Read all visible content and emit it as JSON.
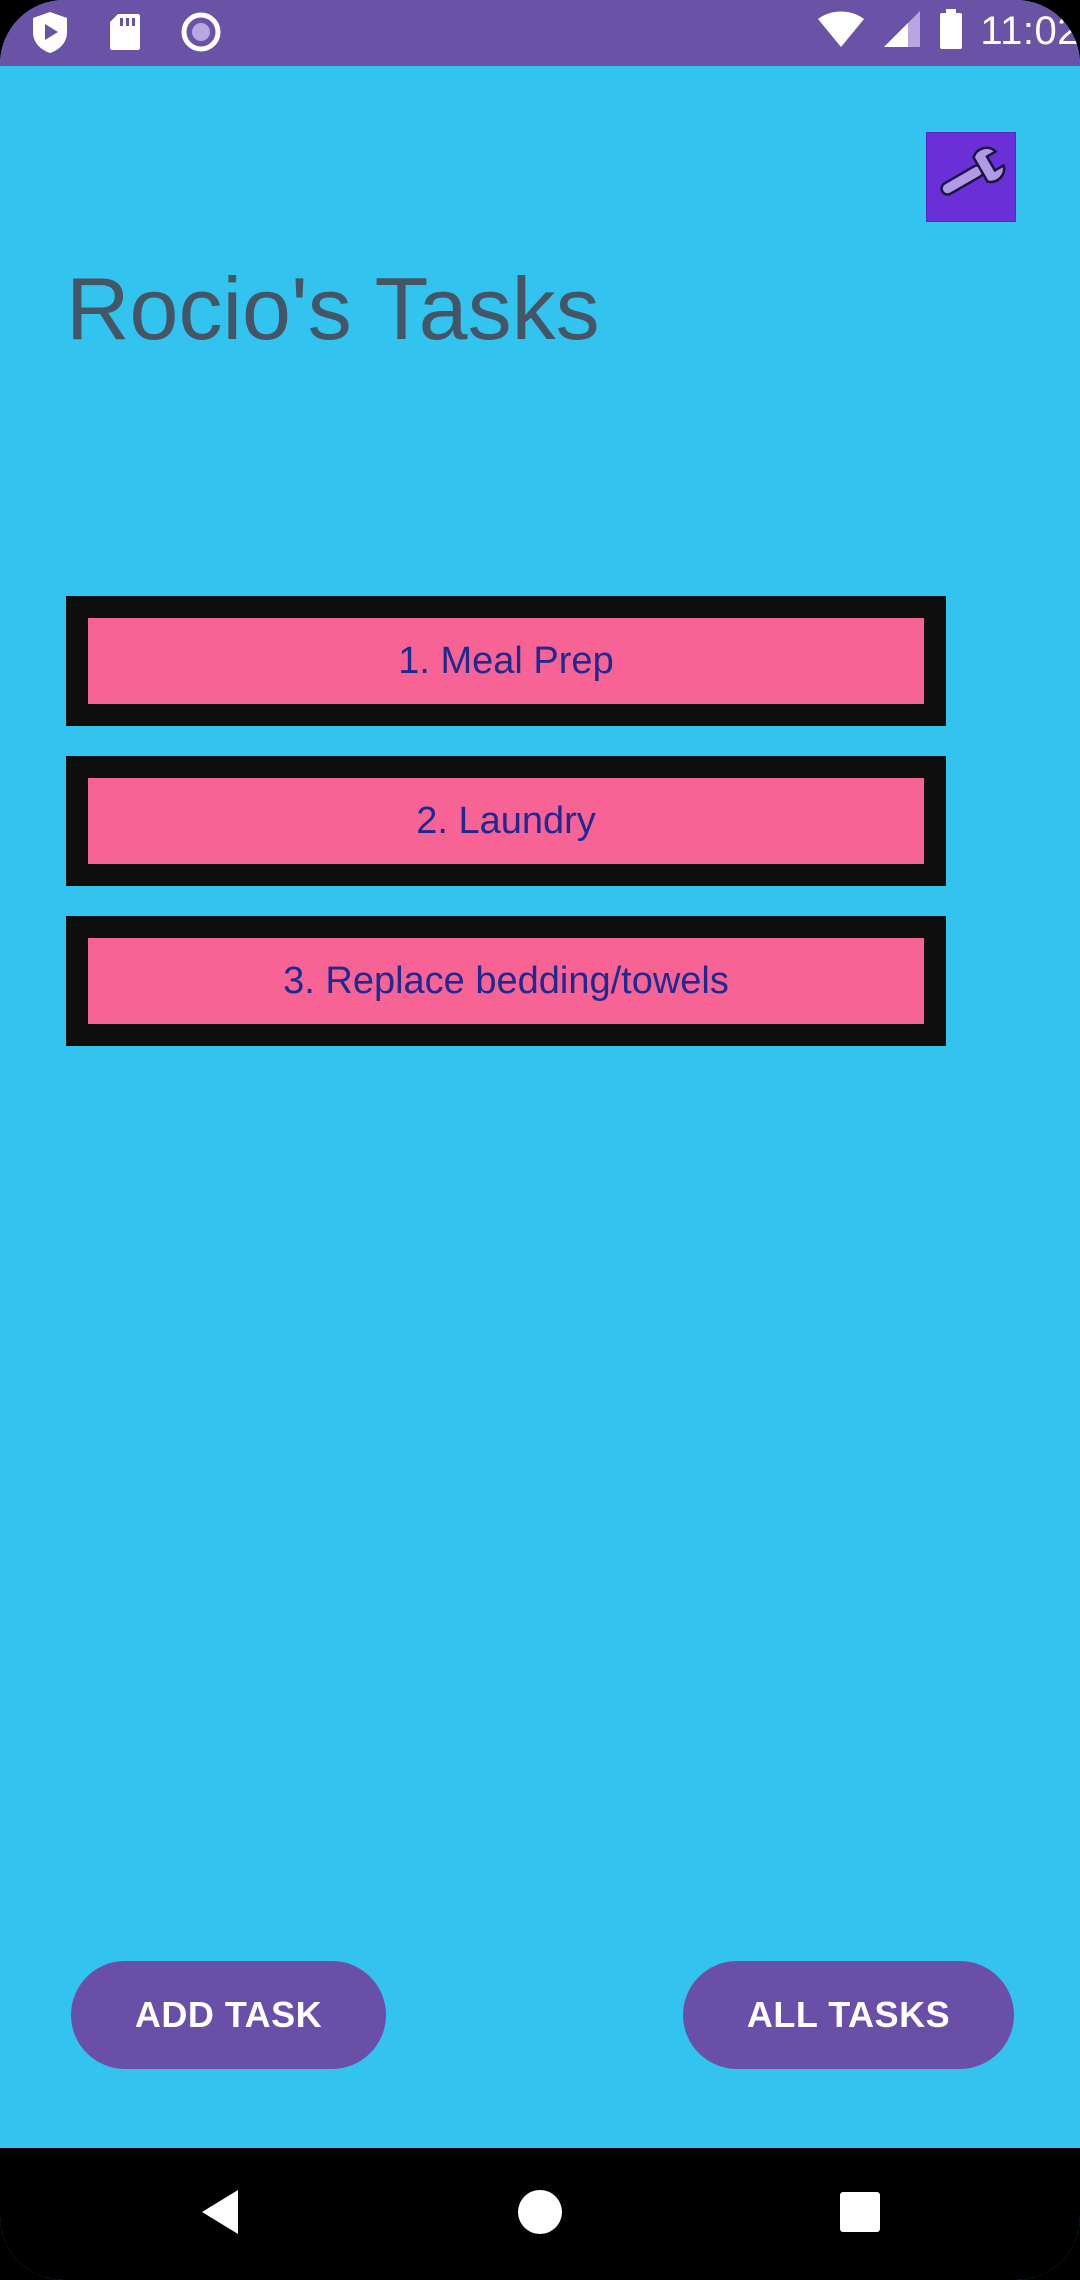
{
  "status_bar": {
    "time": "11:02",
    "left_icons": [
      "shield-play-icon",
      "sd-card-icon",
      "record-circle-icon"
    ],
    "right_icons": [
      "wifi-icon",
      "cell-signal-icon",
      "battery-icon"
    ]
  },
  "header": {
    "title": "Rocio's Tasks",
    "settings_icon": "wrench-icon"
  },
  "tasks": [
    {
      "label": "1. Meal Prep"
    },
    {
      "label": "2. Laundry"
    },
    {
      "label": "3. Replace bedding/towels"
    }
  ],
  "footer": {
    "add_task_label": "ADD TASK",
    "all_tasks_label": "ALL TASKS"
  },
  "colors": {
    "background": "#33c3ef",
    "status_bar": "#6a53a6",
    "task_fill": "#f76395",
    "task_border": "#0f0f10",
    "task_text": "#1e2a90",
    "button": "#6a4fa8",
    "wrench_bg": "#6a2fd6"
  },
  "nav_bar": {
    "icons": [
      "back-icon",
      "home-icon",
      "recents-icon"
    ]
  }
}
